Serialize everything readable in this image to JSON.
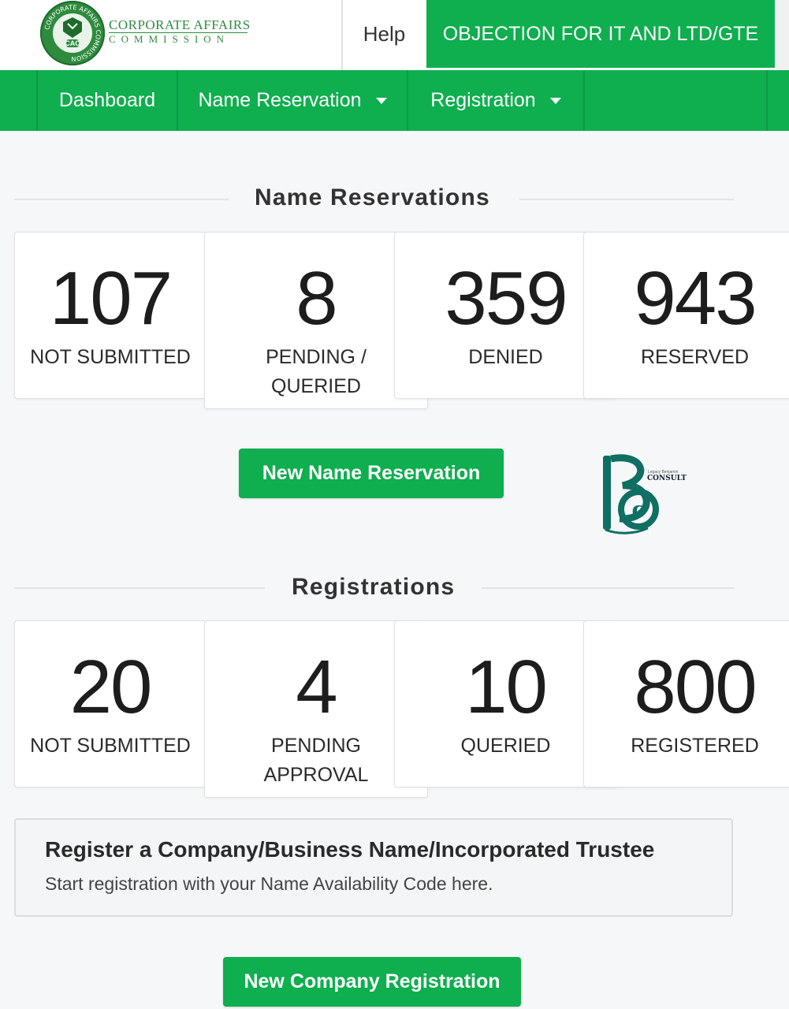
{
  "header": {
    "brand_line1": "CORPORATE AFFAIRS",
    "brand_line2": "COMMISSION",
    "seal_ring_text": "CORPORATE AFFAIRS COMMISSION",
    "seal_label": "CAC",
    "help_label": "Help",
    "objection_label": "OBJECTION FOR IT AND LTD/GTE"
  },
  "nav": {
    "items": [
      {
        "label": "Dashboard"
      },
      {
        "label": "Name Reservation"
      },
      {
        "label": "Registration"
      }
    ]
  },
  "name_reservations": {
    "title": "Name Reservations",
    "cards": [
      {
        "value": "107",
        "label": "NOT SUBMITTED"
      },
      {
        "value": "8",
        "label": "PENDING / QUERIED"
      },
      {
        "value": "359",
        "label": "DENIED"
      },
      {
        "value": "943",
        "label": "RESERVED"
      }
    ],
    "button_label": "New Name Reservation"
  },
  "registrations": {
    "title": "Registrations",
    "cards": [
      {
        "value": "20",
        "label": "NOT SUBMITTED"
      },
      {
        "value": "4",
        "label": "PENDING APPROVAL"
      },
      {
        "value": "10",
        "label": "QUERIED"
      },
      {
        "value": "800",
        "label": "REGISTERED"
      }
    ]
  },
  "register_box": {
    "title": "Register a Company/Business Name/Incorporated Trustee",
    "subtitle": "Start registration with your Name Availability Code here."
  },
  "company_button_label": "New Company Registration",
  "watermark": {
    "tagline": "Legacy Benjamin",
    "word": "CONSULT"
  },
  "colors": {
    "brand_green": "#0fae4f",
    "logo_green": "#2e8b3e",
    "watermark_teal": "#0f6f63"
  }
}
